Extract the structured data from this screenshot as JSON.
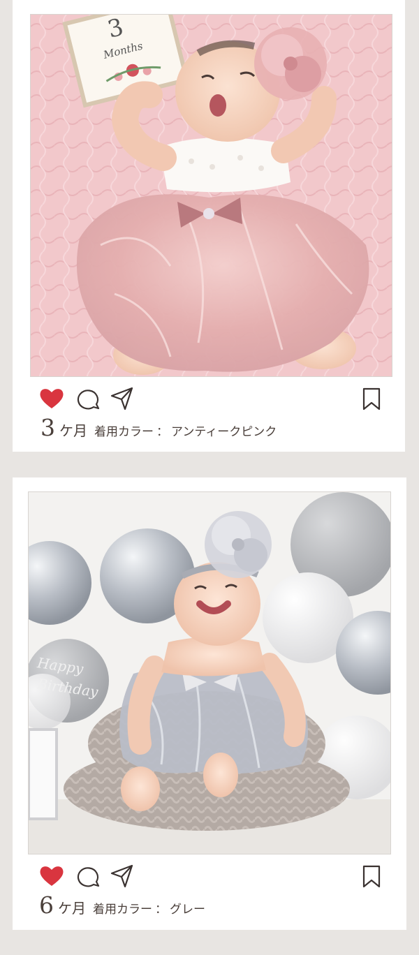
{
  "posts": [
    {
      "month_number": "3",
      "month_unit": "ケ月",
      "color_label": "着用カラー",
      "separator": "：",
      "color_value": "アンティークピンク",
      "photo": {
        "board_text": "3 Months",
        "theme": "antique-pink-tulle-dress"
      }
    },
    {
      "month_number": "6",
      "month_unit": "ケ月",
      "color_label": "着用カラー",
      "separator": "：",
      "color_value": "グレー",
      "photo": {
        "cake_topper_text": "Happy Birthday",
        "theme": "gray-tulle-dress"
      }
    }
  ],
  "icons": {
    "like": "heart-icon",
    "comment": "comment-icon",
    "share": "share-icon",
    "save": "bookmark-icon"
  },
  "colors": {
    "heart": "#d9353f",
    "icon_stroke": "#3a3230",
    "page_bg": "#e8e5e2",
    "card_bg": "#ffffff"
  }
}
